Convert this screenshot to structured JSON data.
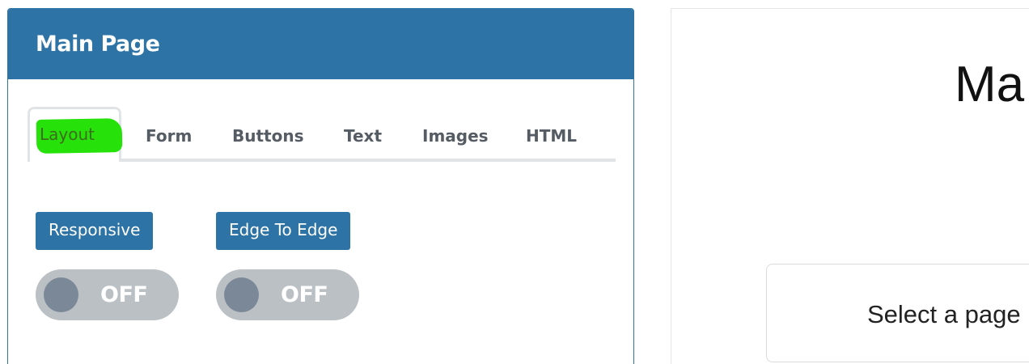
{
  "panel": {
    "title": "Main Page"
  },
  "tabs": [
    {
      "label": "Layout",
      "active": true
    },
    {
      "label": "Form",
      "active": false
    },
    {
      "label": "Buttons",
      "active": false
    },
    {
      "label": "Text",
      "active": false
    },
    {
      "label": "Images",
      "active": false
    },
    {
      "label": "HTML",
      "active": false
    }
  ],
  "options": {
    "responsive": {
      "label": "Responsive",
      "state": "OFF"
    },
    "edge_to_edge": {
      "label": "Edge To Edge",
      "state": "OFF"
    }
  },
  "preview": {
    "title": "Ma",
    "message": "Select a page"
  },
  "colors": {
    "header": "#2d73a5",
    "highlight": "#26e20a",
    "toggle_track": "#bbc0c5",
    "toggle_knob": "#7b8898"
  }
}
